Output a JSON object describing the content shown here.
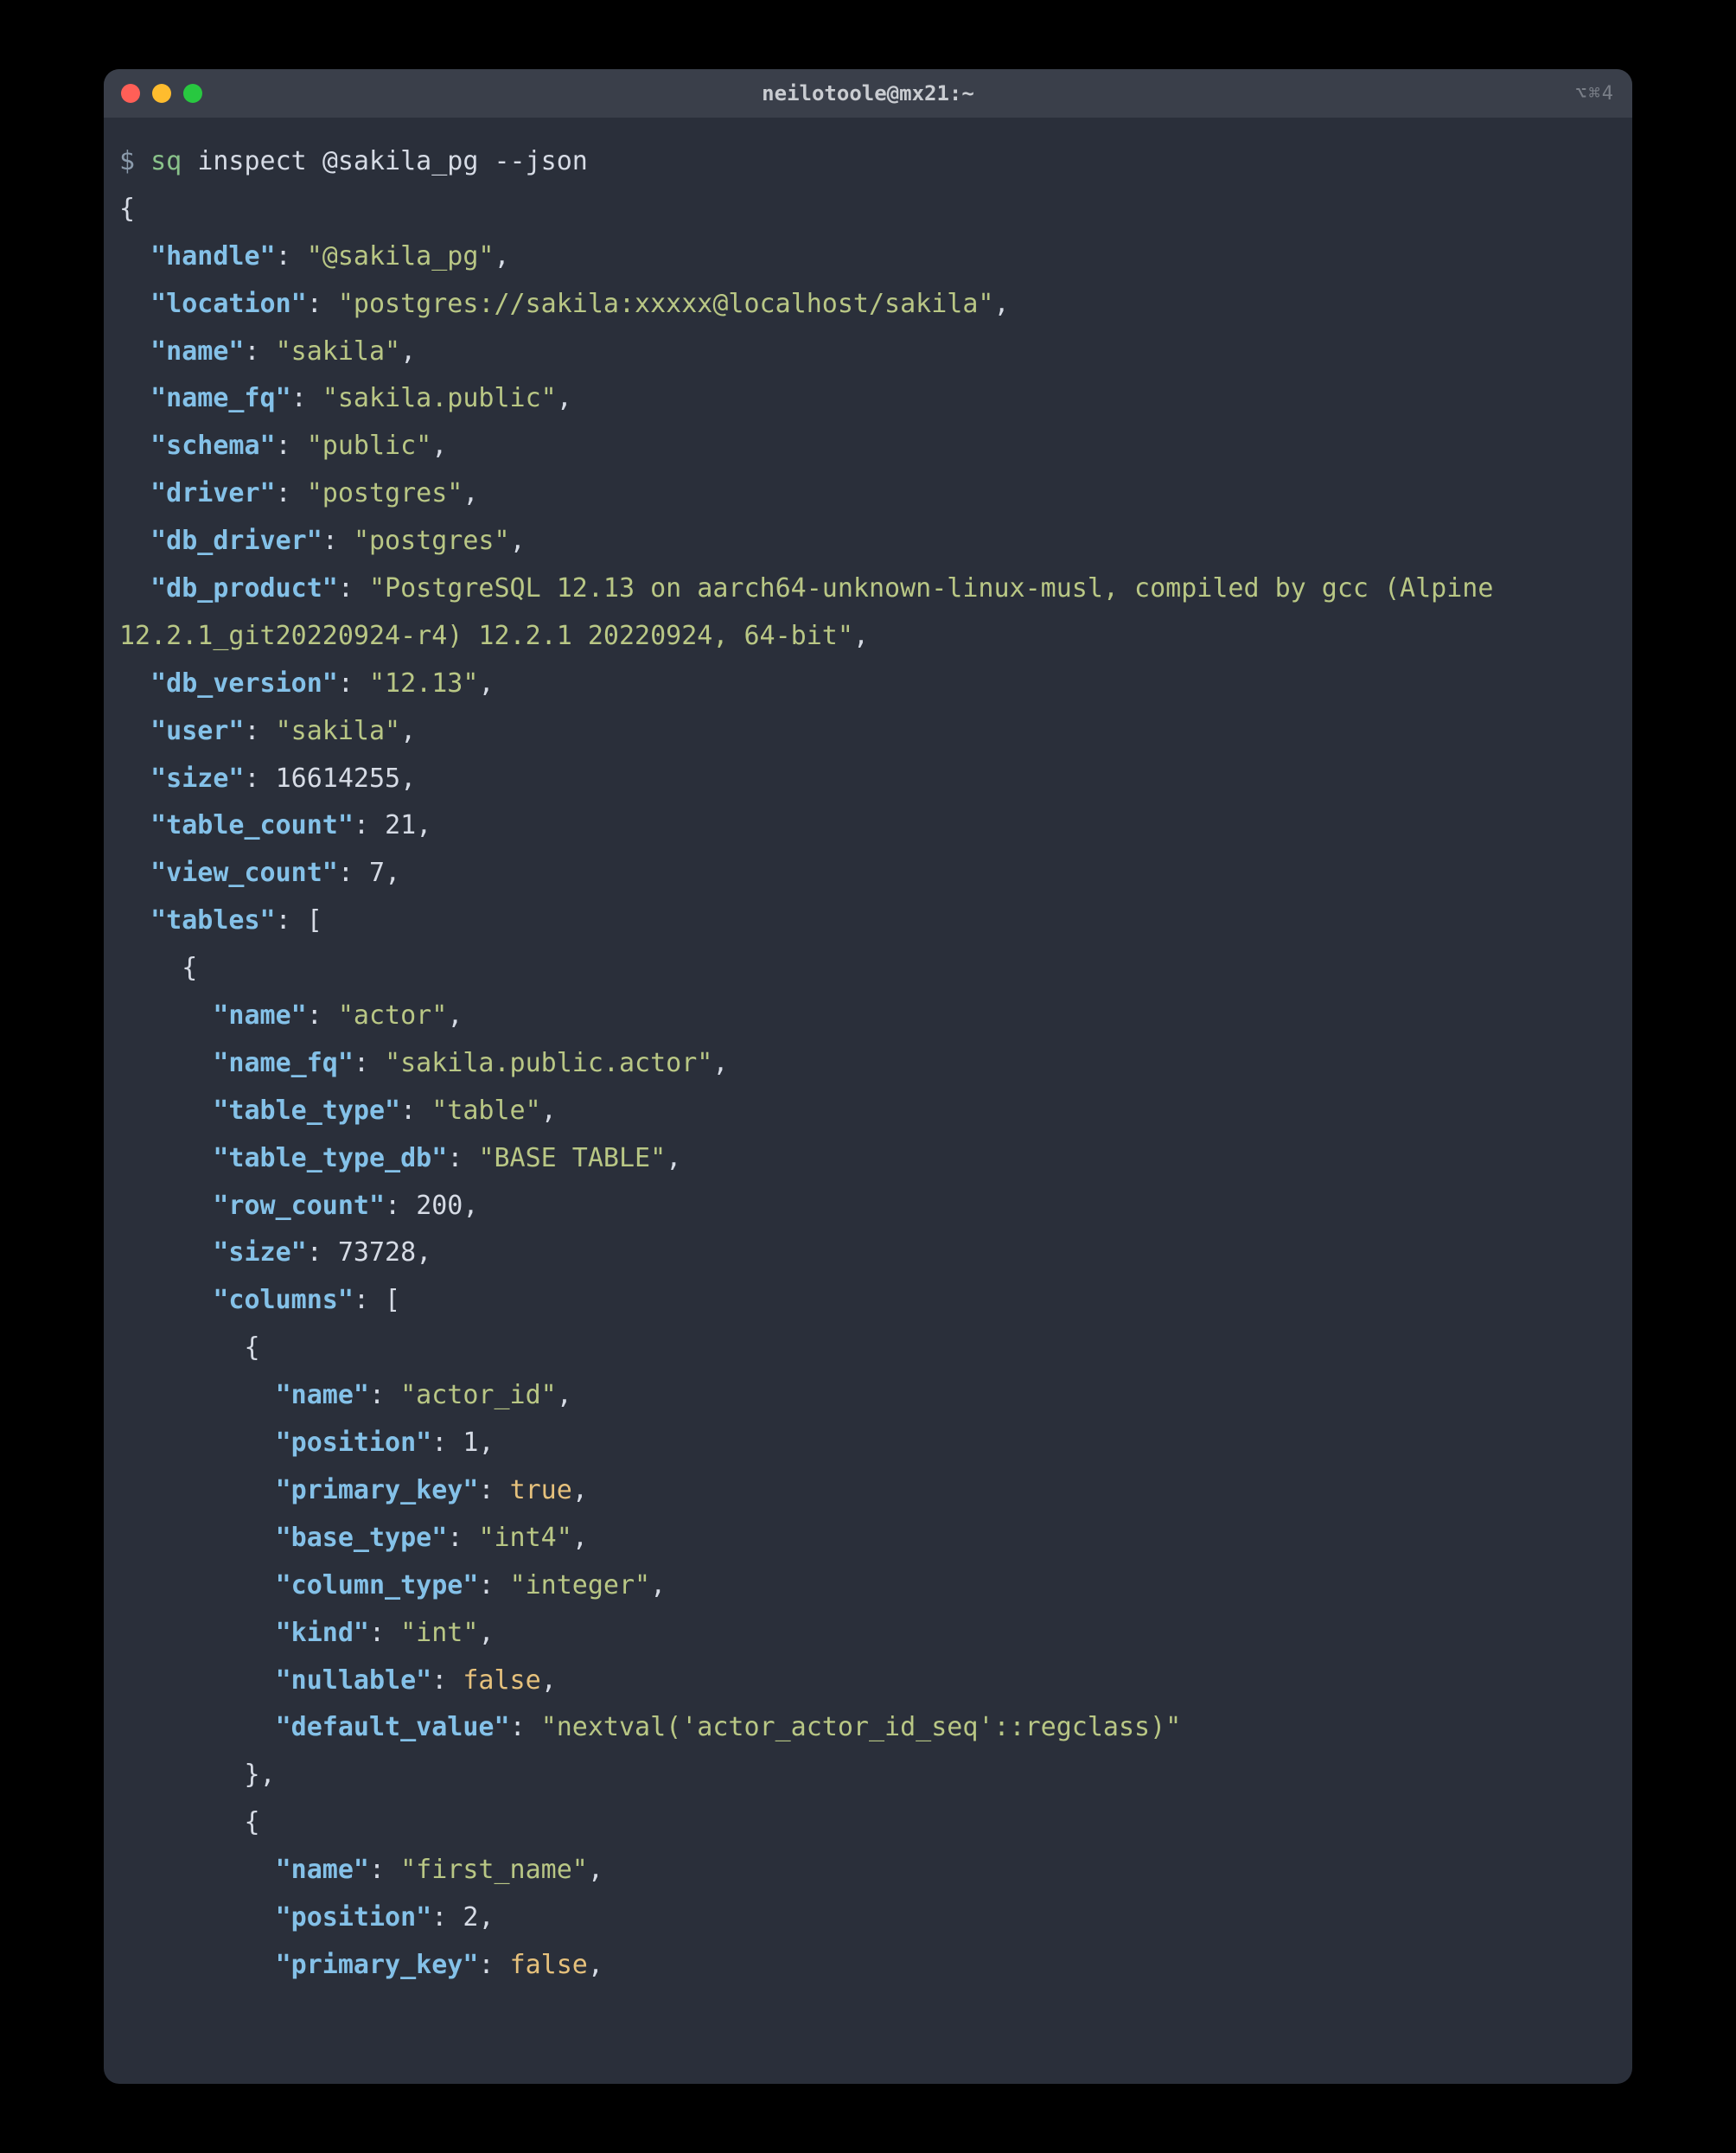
{
  "window": {
    "title": "neilotoole@mx21:~",
    "shortcut": "⌥⌘4"
  },
  "prompt": "$",
  "command": {
    "bin": "sq",
    "sub": "inspect",
    "target": "@sakila_pg",
    "flag": "--json"
  },
  "json": {
    "handle_key": "\"handle\"",
    "handle_val": "\"@sakila_pg\"",
    "location_key": "\"location\"",
    "location_val": "\"postgres://sakila:xxxxx@localhost/sakila\"",
    "name_key": "\"name\"",
    "name_val": "\"sakila\"",
    "name_fq_key": "\"name_fq\"",
    "name_fq_val": "\"sakila.public\"",
    "schema_key": "\"schema\"",
    "schema_val": "\"public\"",
    "driver_key": "\"driver\"",
    "driver_val": "\"postgres\"",
    "db_driver_key": "\"db_driver\"",
    "db_driver_val": "\"postgres\"",
    "db_product_key": "\"db_product\"",
    "db_product_val": "\"PostgreSQL 12.13 on aarch64-unknown-linux-musl, compiled by gcc (Alpine 12.2.1_git20220924-r4) 12.2.1 20220924, 64-bit\"",
    "db_version_key": "\"db_version\"",
    "db_version_val": "\"12.13\"",
    "user_key": "\"user\"",
    "user_val": "\"sakila\"",
    "size_key": "\"size\"",
    "size_val": "16614255",
    "table_count_key": "\"table_count\"",
    "table_count_val": "21",
    "view_count_key": "\"view_count\"",
    "view_count_val": "7",
    "tables_key": "\"tables\"",
    "t0": {
      "name_key": "\"name\"",
      "name_val": "\"actor\"",
      "name_fq_key": "\"name_fq\"",
      "name_fq_val": "\"sakila.public.actor\"",
      "table_type_key": "\"table_type\"",
      "table_type_val": "\"table\"",
      "table_type_db_key": "\"table_type_db\"",
      "table_type_db_val": "\"BASE TABLE\"",
      "row_count_key": "\"row_count\"",
      "row_count_val": "200",
      "size_key": "\"size\"",
      "size_val": "73728",
      "columns_key": "\"columns\"",
      "c0": {
        "name_key": "\"name\"",
        "name_val": "\"actor_id\"",
        "position_key": "\"position\"",
        "position_val": "1",
        "primary_key_key": "\"primary_key\"",
        "primary_key_val": "true",
        "base_type_key": "\"base_type\"",
        "base_type_val": "\"int4\"",
        "column_type_key": "\"column_type\"",
        "column_type_val": "\"integer\"",
        "kind_key": "\"kind\"",
        "kind_val": "\"int\"",
        "nullable_key": "\"nullable\"",
        "nullable_val": "false",
        "default_value_key": "\"default_value\"",
        "default_value_val": "\"nextval('actor_actor_id_seq'::regclass)\""
      },
      "c1": {
        "name_key": "\"name\"",
        "name_val": "\"first_name\"",
        "position_key": "\"position\"",
        "position_val": "2",
        "primary_key_key": "\"primary_key\"",
        "primary_key_val": "false"
      }
    }
  }
}
